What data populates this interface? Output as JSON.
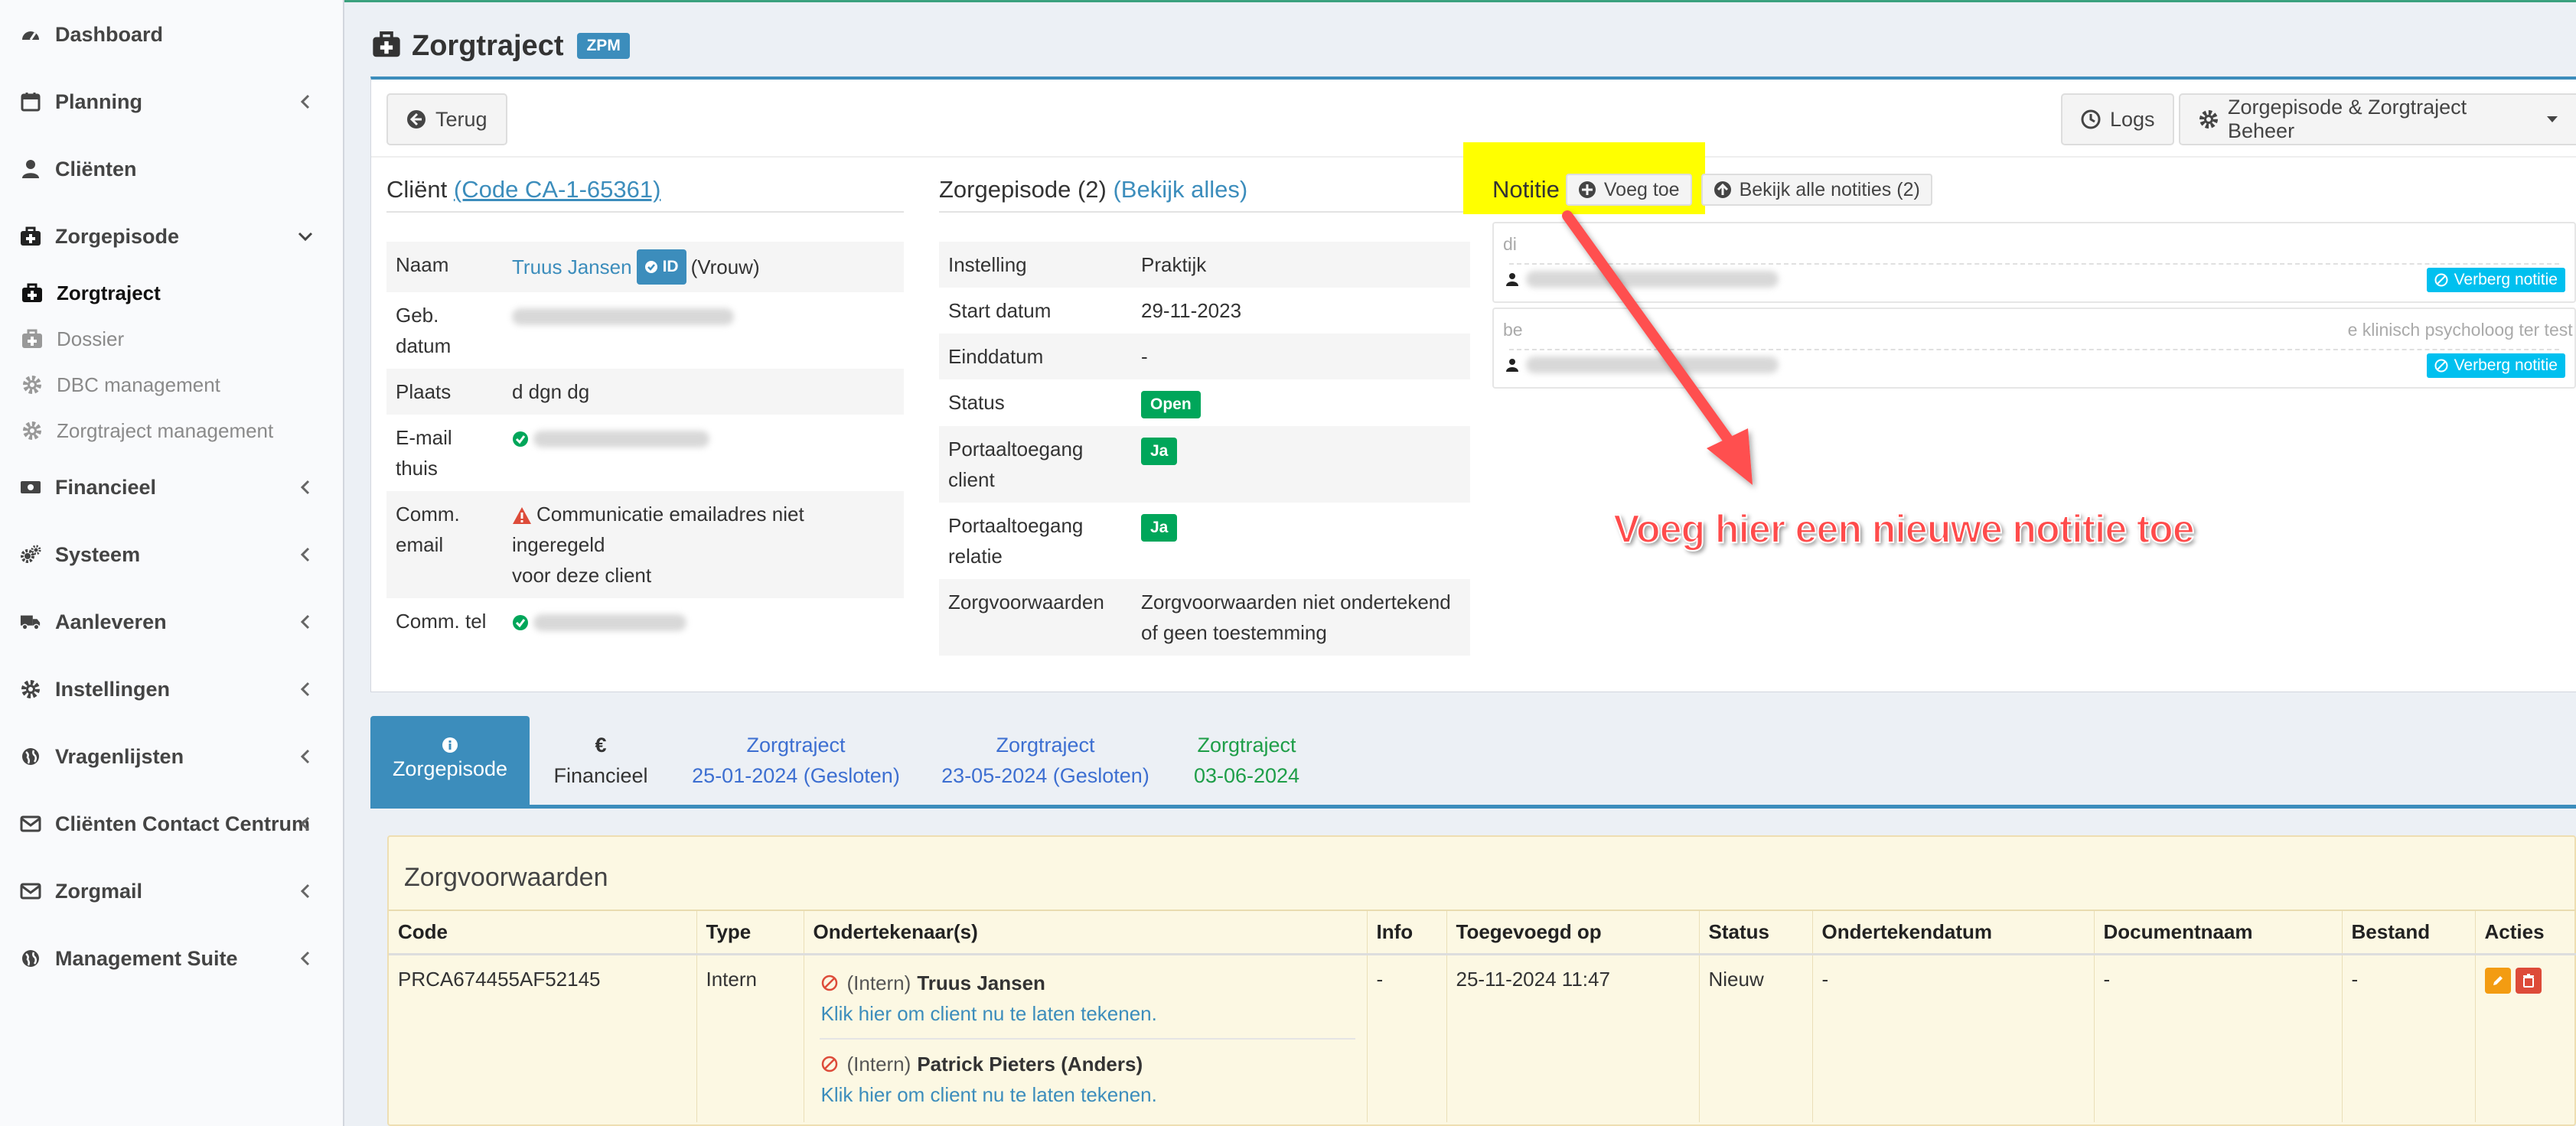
{
  "sidebar": {
    "items": [
      {
        "label": "Dashboard",
        "icon": "dashboard-icon"
      },
      {
        "label": "Planning",
        "icon": "calendar-icon"
      },
      {
        "label": "Cliënten",
        "icon": "user-icon"
      },
      {
        "label": "Zorgepisode",
        "icon": "medkit-icon"
      },
      {
        "label": "Financieel",
        "icon": "money-icon"
      },
      {
        "label": "Systeem",
        "icon": "cogs-icon"
      },
      {
        "label": "Aanleveren",
        "icon": "truck-icon"
      },
      {
        "label": "Instellingen",
        "icon": "cog-icon"
      },
      {
        "label": "Vragenlijsten",
        "icon": "globe-icon"
      },
      {
        "label": "Cliënten Contact Centrum",
        "icon": "envelope-icon"
      },
      {
        "label": "Zorgmail",
        "icon": "envelope-icon"
      },
      {
        "label": "Management Suite",
        "icon": "globe-icon"
      }
    ],
    "subitems": [
      {
        "label": "Zorgtraject",
        "icon": "medkit-icon",
        "active": true
      },
      {
        "label": "Dossier",
        "icon": "medkit-icon"
      },
      {
        "label": "DBC management",
        "icon": "cog-icon"
      },
      {
        "label": "Zorgtraject management",
        "icon": "cog-icon"
      }
    ]
  },
  "header": {
    "title": "Zorgtraject",
    "badge": "ZPM"
  },
  "toolbar": {
    "back_label": "Terug",
    "logs_label": "Logs",
    "beheer_label": "Zorgepisode & Zorgtraject Beheer"
  },
  "client": {
    "title": "Cliënt",
    "code_link": "(Code CA-1-65361)",
    "rows": {
      "naam_label": "Naam",
      "naam_value": "Truus Jansen",
      "id_badge": "ID",
      "gender": "(Vrouw)",
      "geb_label_1": "Geb.",
      "geb_label_2": "datum",
      "plaats_label": "Plaats",
      "plaats_value": "d dgn dg",
      "email_label_1": "E-mail",
      "email_label_2": "thuis",
      "comm_email_label_1": "Comm.",
      "comm_email_label_2": "email",
      "comm_email_value_1": "Communicatie emailadres niet ingeregeld",
      "comm_email_value_2": "voor deze client",
      "comm_tel_label": "Comm. tel"
    }
  },
  "zorgepisode": {
    "title": "Zorgepisode (2)",
    "link": "(Bekijk alles)",
    "rows": {
      "instelling_label": "Instelling",
      "instelling_value": "Praktijk",
      "start_label": "Start datum",
      "start_value": "29-11-2023",
      "eind_label": "Einddatum",
      "eind_value": "-",
      "status_label": "Status",
      "status_value": "Open",
      "portaal_client_label_1": "Portaaltoegang",
      "portaal_client_label_2": "client",
      "portaal_client_value": "Ja",
      "portaal_relatie_label_1": "Portaaltoegang",
      "portaal_relatie_label_2": "relatie",
      "portaal_relatie_value": "Ja",
      "zorgvoorwaarden_label": "Zorgvoorwaarden",
      "zorgvoorwaarden_value_1": "Zorgvoorwaarden niet ondertekend",
      "zorgvoorwaarden_value_2": "of geen toestemming"
    }
  },
  "notities": {
    "title": "Notitie",
    "add_label": "Voeg toe",
    "view_all_label": "Bekijk alle notities (2)",
    "notes": [
      {
        "text": "di",
        "hide_label": "Verberg notitie"
      },
      {
        "text_start": "be",
        "text_end": "e klinisch psycholoog ter test",
        "hide_label": "Verberg notitie"
      }
    ],
    "annotation": "Voeg hier een nieuwe notitie toe",
    "highlight_color": "#ffff00",
    "annotation_color": "#ff4b4b"
  },
  "tabs": [
    {
      "icon": "info-icon",
      "icon_glyph": "i",
      "label": "Zorgepisode",
      "active": true
    },
    {
      "icon": "euro-icon",
      "icon_glyph": "€",
      "label": "Financieel"
    },
    {
      "line1": "Zorgtraject",
      "line2": "25-01-2024 (Gesloten)",
      "color": "#3d6fd1"
    },
    {
      "line1": "Zorgtraject",
      "line2": "23-05-2024 (Gesloten)",
      "color": "#3d6fd1"
    },
    {
      "line1": "Zorgtraject",
      "line2": "03-06-2024",
      "color": "#1e9e48"
    }
  ],
  "zorgvoorwaarden": {
    "title": "Zorgvoorwaarden",
    "columns": [
      "Code",
      "Type",
      "Ondertekenaar(s)",
      "Info",
      "Toegevoegd op",
      "Status",
      "Ondertekendatum",
      "Documentnaam",
      "Bestand",
      "Acties"
    ],
    "row": {
      "code": "PRCA674455AF52145",
      "type": "Intern",
      "signers": [
        {
          "prefix": "(Intern)",
          "name": "Truus Jansen",
          "link": "Klik hier om client nu te laten tekenen."
        },
        {
          "prefix": "(Intern)",
          "name": "Patrick Pieters (Anders)",
          "link": "Klik hier om client nu te laten tekenen."
        }
      ],
      "info": "-",
      "toegevoegd": "25-11-2024 11:47",
      "status": "Nieuw",
      "ondertekendatum": "-",
      "documentnaam": "-",
      "bestand": "-"
    }
  },
  "colors": {
    "primary": "#3c8dbc",
    "success": "#00a65a",
    "info": "#00c0ef",
    "warning": "#f39c12",
    "danger": "#dd4b39"
  }
}
